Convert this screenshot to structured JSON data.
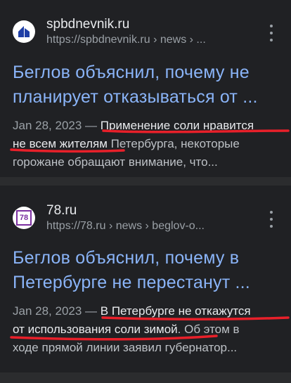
{
  "results": [
    {
      "site_name": "spbdnevnik.ru",
      "url": "https://spbdnevnik.ru",
      "path": " › news › ...",
      "favicon": "spbdnevnik-logo",
      "title_line1": "Беглов объяснил, почему не",
      "title_line2": "планирует отказываться от ...",
      "date": "Jan 28, 2023",
      "dash": " — ",
      "snippet_hl1": "Применение соли нравится",
      "snippet_hl2": "не всем жителям",
      "snippet_rest2": " Петербурга, некоторые",
      "snippet_line3": "горожане обращают внимание, что..."
    },
    {
      "site_name": "78.ru",
      "url": "https://78.ru",
      "path": " › news › beglov-o...",
      "favicon_text": "78",
      "title_line1": "Беглов объяснил, почему в",
      "title_line2": "Петербурге не перестанут ...",
      "date": "Jan 28, 2023",
      "dash": " — ",
      "snippet_hl1": "В Петербурге не откажутся",
      "snippet_hl2": "от использования соли зимой",
      "snippet_rest2": ". Об этом в",
      "snippet_line3": "ходе прямой линии заявил губернатор..."
    }
  ],
  "colors": {
    "background": "#202124",
    "title": "#8ab4f8",
    "underline": "#e8202a",
    "favicon_78": "#7b2fa0"
  }
}
